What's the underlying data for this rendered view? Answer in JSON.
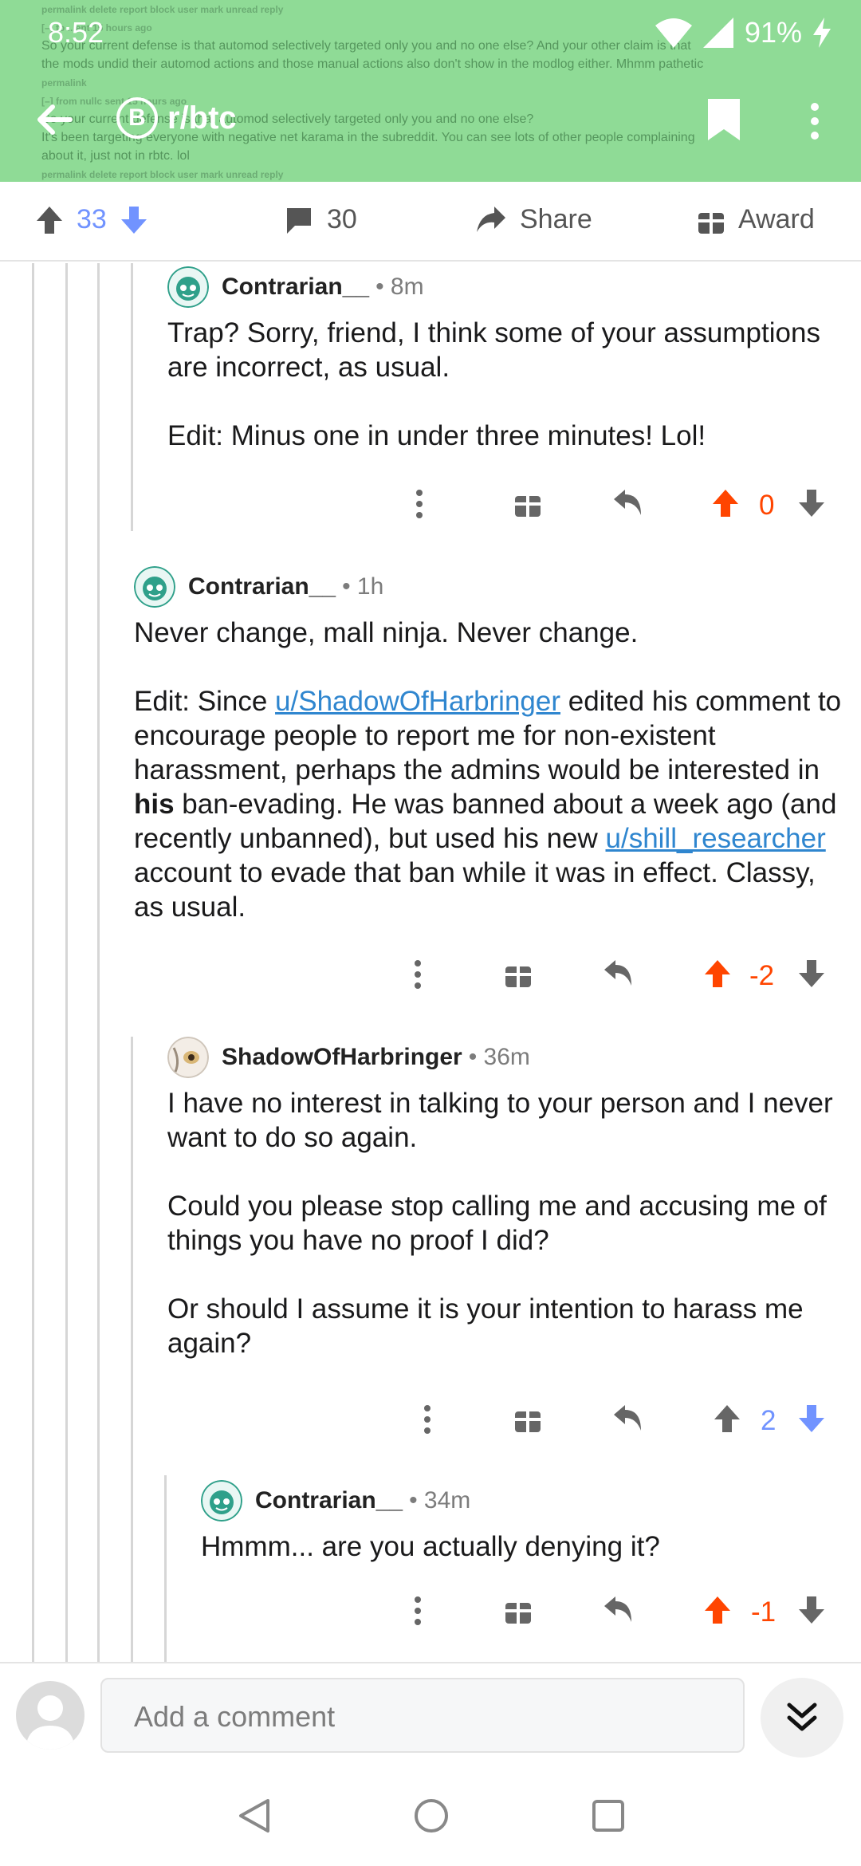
{
  "status_bar": {
    "time": "8:52",
    "battery": "91%"
  },
  "background_text": {
    "line1": "permalink  delete  report  block user  mark unread  reply",
    "line2": "[–] to ...ent 15 hours ago",
    "line3": "So your current defense is that automod selectively targeted only you and no one else? And your other claim is that",
    "line4": "the mods undid their automod actions and those manual actions also don't show in the modlog either. Mhmm pathetic",
    "line5": "permalink",
    "line6": "[–] from nullc  sent 15 hours ago",
    "line7": "So your current defense is that automod selectively targeted only you and no one else?",
    "line8": "It's been targeting everyone with negative net karama in the subreddit. You can see lots of other people complaining",
    "line9": "about it, just not in rbtc. lol",
    "line10": "permalink  delete  report  block user  mark unread  reply"
  },
  "app_bar": {
    "subreddit": "r/btc",
    "sub_icon_letter": "B"
  },
  "post_actions": {
    "score": "33",
    "comments": "30",
    "share": "Share",
    "award": "Award"
  },
  "comments": [
    {
      "author": "Contrarian__",
      "age": "8m",
      "paragraphs": [
        "Trap? Sorry, friend, I think some of your assumptions are incorrect, as usual.",
        "Edit: Minus one in under three minutes! Lol!"
      ],
      "score": "0",
      "vote": "up"
    },
    {
      "author": "Contrarian__",
      "age": "1h",
      "p1": "Never change, mall ninja. Never change.",
      "p2": {
        "t1": "Edit: Since ",
        "link1": "u/ShadowOfHarbringer",
        "t2": " edited his comment to encourage people to report me for non-existent harassment, perhaps the admins would be interested in ",
        "bold": "his",
        "t3": " ban-evading. He was banned about a week ago (and recently unbanned), but used his new ",
        "link2": "u/shill_researcher",
        "t4": " account to evade that ban while it was in effect. Classy, as usual."
      },
      "score": "-2",
      "vote": "up"
    },
    {
      "author": "ShadowOfHarbringer",
      "age": "36m",
      "paragraphs": [
        "I have no interest in talking to your person and I never want to do so again.",
        "Could you please stop calling me and accusing me of things you have no proof I did?",
        "Or should I assume it is your intention to harass me again?"
      ],
      "score": "2",
      "vote": "down"
    },
    {
      "author": "Contrarian__",
      "age": "34m",
      "paragraphs": [
        "Hmmm... are you actually denying it?"
      ],
      "score": "-1",
      "vote": "up"
    }
  ],
  "composer": {
    "placeholder": "Add a comment"
  },
  "colors": {
    "header": "#8fdb96",
    "upvote": "#ff4500",
    "downvote": "#7193ff",
    "link": "#2f86cf"
  },
  "icons": [
    "back-arrow-icon",
    "bitcoin-icon",
    "bookmark-icon",
    "more-vertical-icon",
    "upvote-icon",
    "downvote-icon",
    "comment-icon",
    "share-icon",
    "gift-icon",
    "reply-icon",
    "chevron-double-down-icon",
    "nav-back-icon",
    "nav-home-icon",
    "nav-recents-icon"
  ]
}
